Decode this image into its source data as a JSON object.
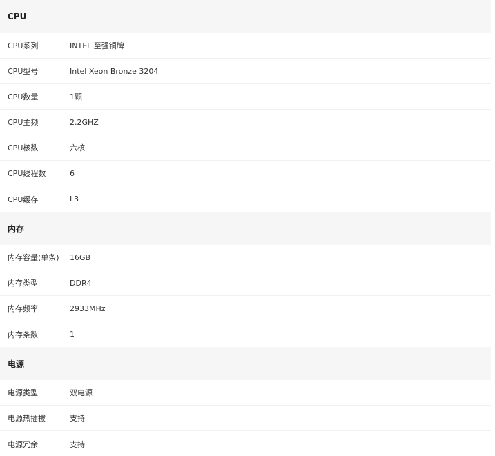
{
  "sections": [
    {
      "title": "CPU",
      "rows": [
        {
          "label": "CPU系列",
          "value": "INTEL 至强铜牌"
        },
        {
          "label": "CPU型号",
          "value": "Intel Xeon Bronze 3204"
        },
        {
          "label": "CPU数量",
          "value": "1颗"
        },
        {
          "label": "CPU主频",
          "value": "2.2GHZ"
        },
        {
          "label": "CPU核数",
          "value": "六核"
        },
        {
          "label": "CPU线程数",
          "value": "6"
        },
        {
          "label": "CPU缓存",
          "value": "L3"
        }
      ]
    },
    {
      "title": "内存",
      "rows": [
        {
          "label": "内存容量(单条)",
          "value": "16GB"
        },
        {
          "label": "内存类型",
          "value": "DDR4"
        },
        {
          "label": "内存频率",
          "value": "2933MHz"
        },
        {
          "label": "内存条数",
          "value": "1"
        }
      ]
    },
    {
      "title": "电源",
      "rows": [
        {
          "label": "电源类型",
          "value": "双电源"
        },
        {
          "label": "电源热插拔",
          "value": "支持"
        },
        {
          "label": "电源冗余",
          "value": "支持"
        }
      ]
    }
  ]
}
